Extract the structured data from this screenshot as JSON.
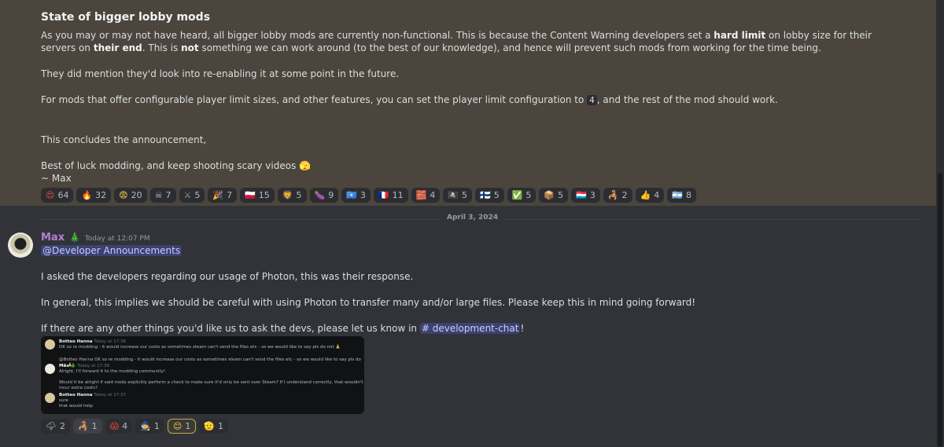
{
  "announcement": {
    "title": "State of bigger lobby mods",
    "p1_a": "As you may or may not have heard, all bigger lobby mods are currently non-functional. This is because the Content Warning developers set a ",
    "p1_b": "hard limit",
    "p1_c": " on lobby size for their servers on ",
    "p1_d": "their end",
    "p1_e": ". This is ",
    "p1_f": "not",
    "p1_g": " something we can work around (to the best of our knowledge), and hence will prevent such mods from working for the time being.",
    "p2": "They did mention they'd look into re-enabling it at some point in the future.",
    "p3_a": "For mods that offer configurable player limit sizes, and other features, you can set the player limit configuration to ",
    "p3_code": "4",
    "p3_b": ", and the rest of the mod should work.",
    "p4": "This concludes the announcement,",
    "p5_a": "Best of luck modding, and keep shooting scary videos ",
    "p5_emoji": "🫣",
    "p6": "~ Max",
    "reactions": [
      {
        "emoji": "😍",
        "count": "64",
        "color": "#e0503c"
      },
      {
        "emoji": "🔥",
        "count": "32",
        "color": "#f28c28"
      },
      {
        "emoji": "😨",
        "count": "20",
        "color": "#f2c14e"
      },
      {
        "emoji": "☠",
        "count": "7",
        "color": "#b5bac1"
      },
      {
        "emoji": "⚔",
        "count": "5",
        "color": "#9aa0a6"
      },
      {
        "emoji": "🎉",
        "count": "7",
        "color": "#d6453d"
      },
      {
        "emoji": "🇵🇱",
        "count": "15",
        "color": "#e8e8e8"
      },
      {
        "emoji": "🦁",
        "count": "5",
        "color": "#c9a066"
      },
      {
        "emoji": "🍆",
        "count": "9",
        "color": "#8e44ad"
      },
      {
        "emoji": "🇸🇴",
        "count": "3",
        "color": "#4189dd"
      },
      {
        "emoji": "🇫🇷",
        "count": "11",
        "color": "#3b5bd9"
      },
      {
        "emoji": "🧱",
        "count": "4",
        "color": "#b5651d"
      },
      {
        "emoji": "🏴‍☠️",
        "count": "5",
        "color": "#d8d8d8"
      },
      {
        "emoji": "🇫🇮",
        "count": "5",
        "color": "#2b6cc4"
      },
      {
        "emoji": "✅",
        "count": "5",
        "color": "#43b581"
      },
      {
        "emoji": "📦",
        "count": "5",
        "color": "#d4762c"
      },
      {
        "emoji": "🇱🇺",
        "count": "3",
        "color": "#e0443c"
      },
      {
        "emoji": "🦂",
        "count": "2",
        "color": "#c49a4a"
      },
      {
        "emoji": "👍",
        "count": "4",
        "color": "#f0c040"
      },
      {
        "emoji": "🇦🇷",
        "count": "8",
        "color": "#74acdf"
      }
    ]
  },
  "divider": {
    "date": "April 3, 2024"
  },
  "message": {
    "author": "Max",
    "author_badge": "🎄",
    "timestamp": "Today at 12:07 PM",
    "mention": "@Developer Announcements",
    "p1": "I asked the developers regarding our usage of Photon, this was their response.",
    "p2": "In general, this implies we should be careful with using Photon to transfer many and/or large files. Please keep this in mind going forward!",
    "p3_a": "If there are any other things you'd like us to ask the devs, please let us know in ",
    "channel": "# development-chat",
    "p3_b": "!",
    "embed": {
      "m1_name": "Botteo Hanna",
      "m1_time": "Today at 17:36",
      "m1_text": "OK so re modding - it would increase our costs as sometimes steam can't send the files etc - so we would like to say pls do not 🙏",
      "reply_text": "@Botteo Hanna OK so re modding - it would increase our costs as sometimes steam can't send the files etc - so we would like to say pls do not 🙏",
      "m2_name": "Max 🎄",
      "m2_time": "Today at 17:38",
      "m2_text": "Alright, I'll forward it to the modding community!",
      "m2_text2": "Would it be alright if said mods explicitly perform a check to make sure it'd only be sent over Steam? If I understand correctly, that wouldn't incur extra costs?",
      "m3_name": "Botteo Hanna",
      "m3_time": "Today at 17:37",
      "m3_text": "sure",
      "m3_text2": "that would help"
    },
    "reactions": [
      {
        "emoji": "🌩",
        "count": "2",
        "color": "#d0d0d0"
      },
      {
        "emoji": "🦂",
        "count": "1",
        "color": "#c49a4a"
      },
      {
        "emoji": "😱",
        "count": "4",
        "color": "#d6453d"
      },
      {
        "emoji": "🧙",
        "count": "1",
        "color": "#4a7fd6"
      },
      {
        "emoji": "😊",
        "count": "1",
        "color": "#f2c14e"
      },
      {
        "emoji": "🫡",
        "count": "1",
        "color": "#f2c14e"
      }
    ]
  }
}
